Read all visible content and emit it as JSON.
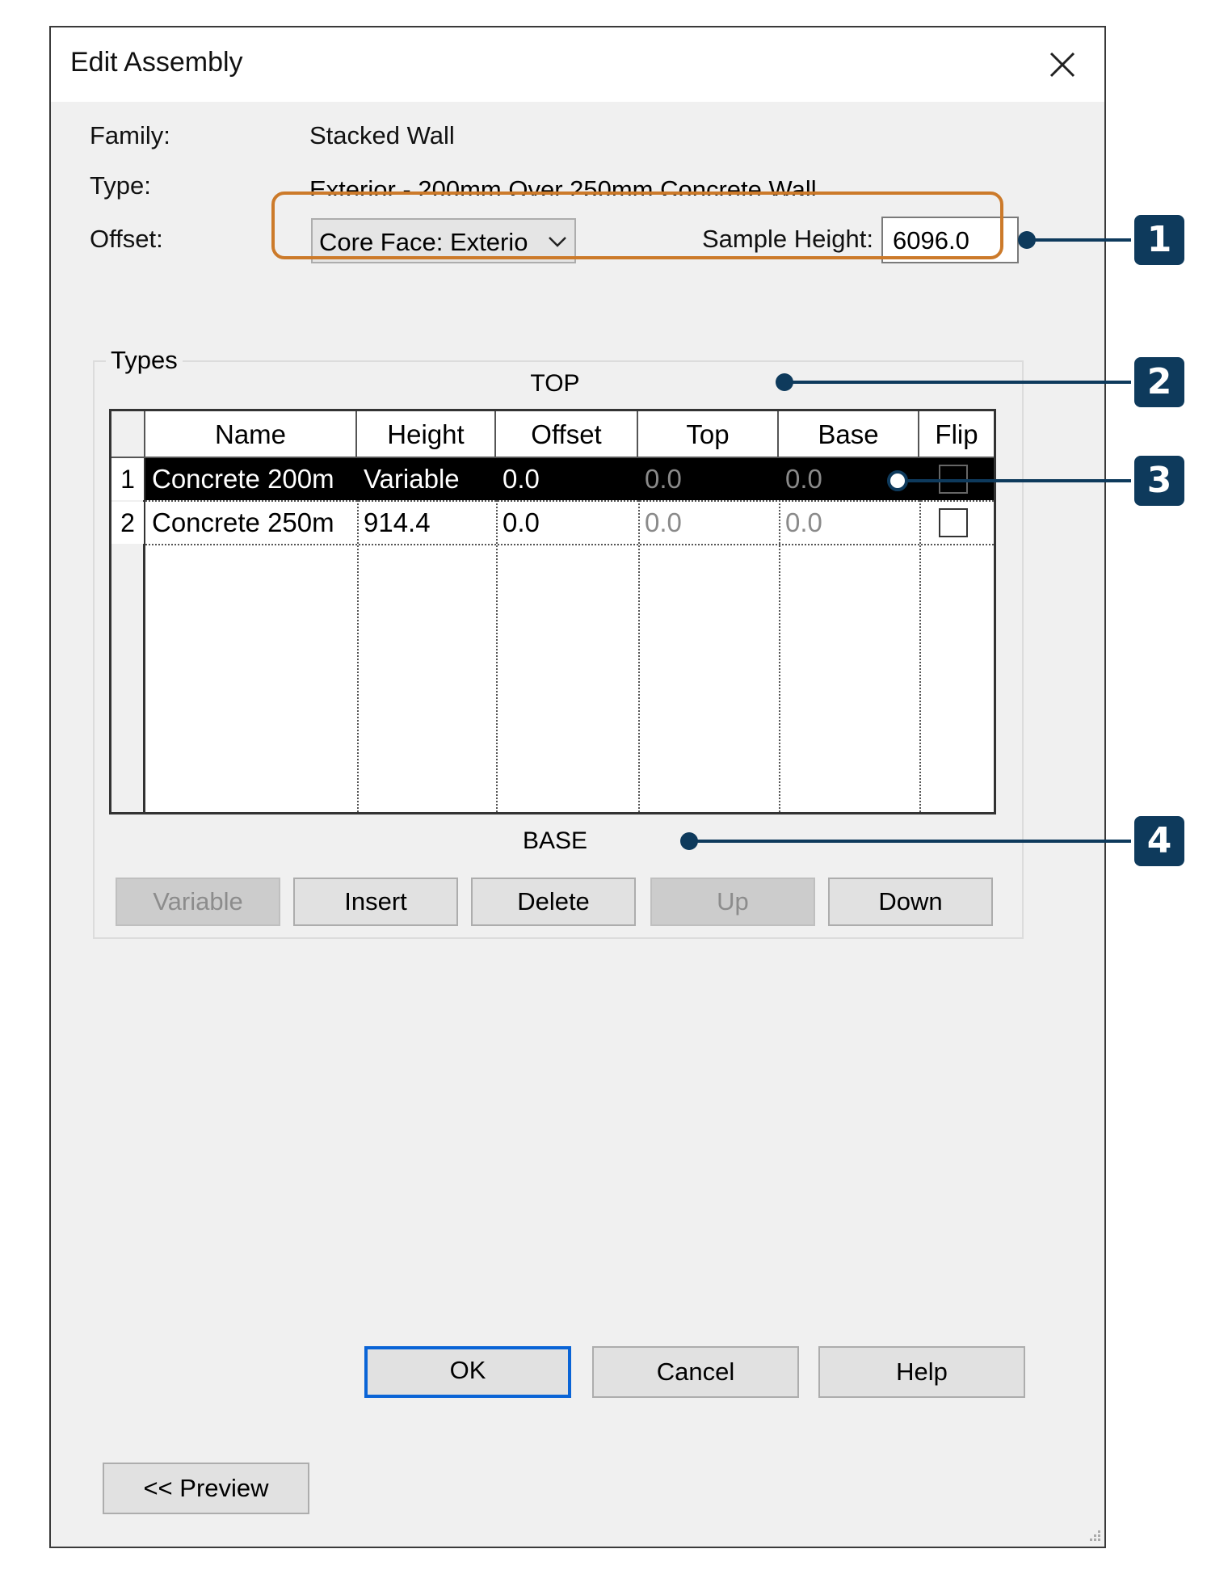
{
  "dialog": {
    "title": "Edit Assembly"
  },
  "fields": {
    "family_label": "Family:",
    "family_value": "Stacked Wall",
    "type_label": "Type:",
    "type_value": "Exterior - 200mm Over 250mm Concrete Wall",
    "offset_label": "Offset:",
    "offset_value": "Core Face: Exterio",
    "sample_height_label": "Sample Height:",
    "sample_height_value": "6096.0"
  },
  "types": {
    "group_label": "Types",
    "top_label": "TOP",
    "base_label": "BASE",
    "columns": [
      "Name",
      "Height",
      "Offset",
      "Top",
      "Base",
      "Flip"
    ],
    "rows": [
      {
        "num": "1",
        "name": "Concrete 200m",
        "height": "Variable",
        "offset": "0.0",
        "top": "0.0",
        "base": "0.0",
        "flip": false,
        "selected": true
      },
      {
        "num": "2",
        "name": "Concrete 250m",
        "height": "914.4",
        "offset": "0.0",
        "top": "0.0",
        "base": "0.0",
        "flip": false,
        "selected": false
      }
    ],
    "buttons": {
      "variable": "Variable",
      "insert": "Insert",
      "delete": "Delete",
      "up": "Up",
      "down": "Down"
    }
  },
  "footer": {
    "ok": "OK",
    "cancel": "Cancel",
    "help": "Help",
    "preview": "<< Preview"
  },
  "callouts": [
    "1",
    "2",
    "3",
    "4"
  ],
  "colors": {
    "callout": "#0e3a5c",
    "highlight": "#cc7a2a",
    "default_button_border": "#0a64d6"
  }
}
